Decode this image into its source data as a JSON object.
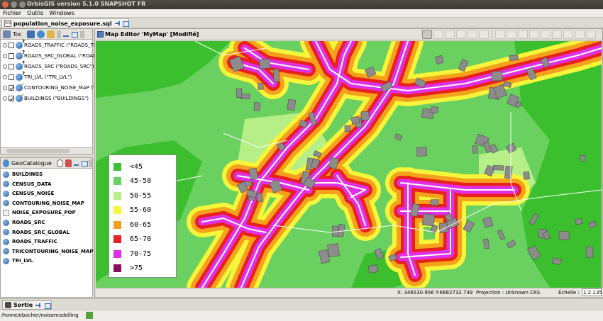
{
  "window": {
    "title": "OrbisGIS version 5.1.0 SNAPSHOT FR"
  },
  "menu": [
    "Fichier",
    "Outils",
    "Windows"
  ],
  "doc_tab": {
    "label": "population_noise_exposure.sql"
  },
  "toc": {
    "title": "Toc",
    "layers": [
      {
        "label": "ROADS_TRAFFIC (\"ROADS_TR",
        "checked": false
      },
      {
        "label": "ROADS_SRC_GLOBAL (\"ROAD",
        "checked": false
      },
      {
        "label": "ROADS_SRC (\"ROADS_SRC\")",
        "checked": false
      },
      {
        "label": "TRI_LVL (\"TRI_LVL\")",
        "checked": false
      },
      {
        "label": "CONTOURING_NOISE_MAP (\"C",
        "checked": true
      },
      {
        "label": "BUILDINGS (\"BUILDINGS\")",
        "checked": true
      }
    ]
  },
  "geocatalogue": {
    "title": "GeoCatalogue",
    "items": [
      "BUILDINGS",
      "CENSUS_DATA",
      "CENSUS_NOISE",
      "CONTOURING_NOISE_MAP",
      "NOISE_EXPOSURE_POP",
      "ROADS_SRC",
      "ROADS_SRC_GLOBAL",
      "ROADS_TRAFFIC",
      "TRICONTOURING_NOISE_MAP",
      "TRI_LVL"
    ]
  },
  "map": {
    "title": "Map Editor 'MyMap' [Modifié]",
    "legend": [
      {
        "label": "<45",
        "color": "#3cbf2e"
      },
      {
        "label": "45-50",
        "color": "#6ad060"
      },
      {
        "label": "50-55",
        "color": "#b6ee88"
      },
      {
        "label": "55-60",
        "color": "#f5f53a"
      },
      {
        "label": "60-65",
        "color": "#f5a11c"
      },
      {
        "label": "65-70",
        "color": "#e8201e"
      },
      {
        "label": "70-75",
        "color": "#e12fe8"
      },
      {
        "label": ">75",
        "color": "#8a0f5a"
      }
    ],
    "status": {
      "coords": "X: 346530.956 Y:6682732.749",
      "projection": "Projection : Unknown CRS",
      "scale_label": "Échelle :",
      "scale_value": "1:2 135"
    }
  },
  "output_tab": {
    "label": "Sortie"
  },
  "footer": {
    "path": "/home/ebocher/noisemodelling"
  }
}
